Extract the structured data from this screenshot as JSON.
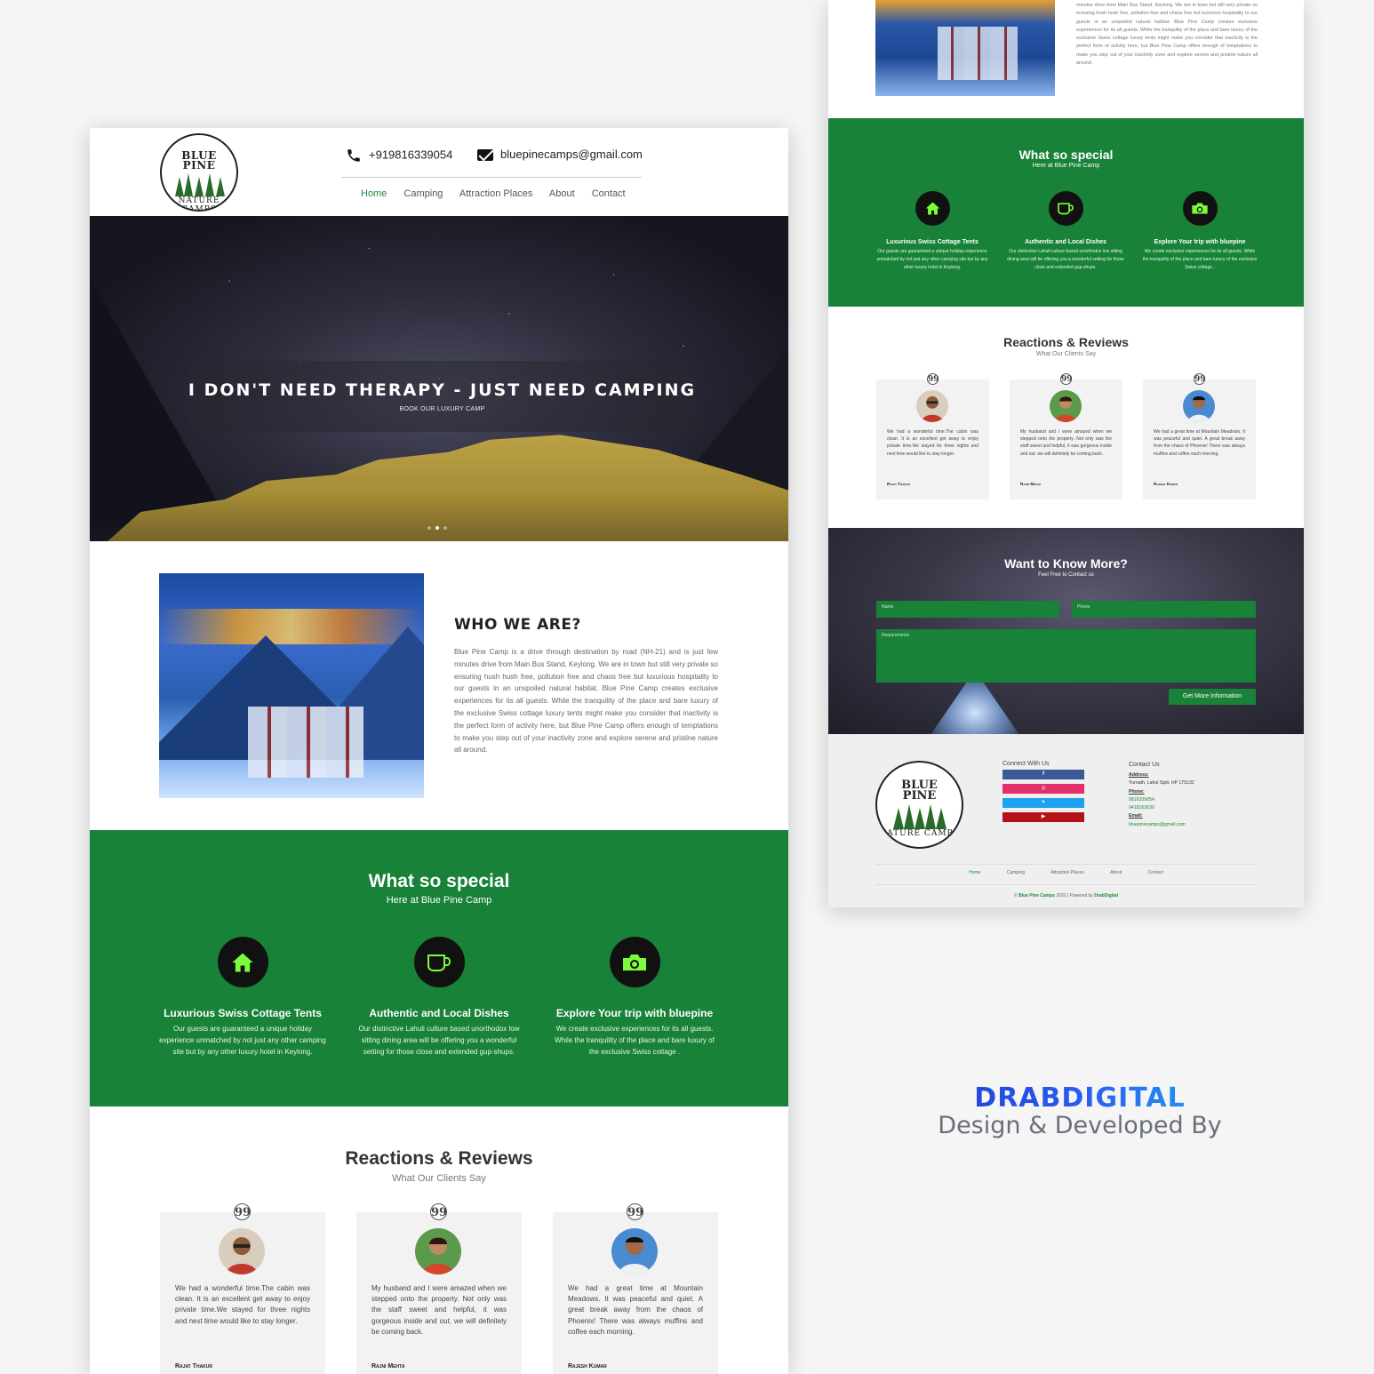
{
  "site": {
    "logo": {
      "line1": "BLUE",
      "line2": "PINE",
      "ring": "NATURE CAMPS"
    },
    "phone": "+919816339054",
    "email": "bluepinecamps@gmail.com",
    "nav": [
      "Home",
      "Camping",
      "Attraction Places",
      "About",
      "Contact"
    ],
    "active_nav": "Home"
  },
  "hero": {
    "title": "I DON'T NEED THERAPY - JUST NEED CAMPING",
    "subtitle": "BOOK OUR LUXURY CAMP"
  },
  "who": {
    "title": "WHO WE ARE?",
    "body": "Blue Pine Camp is a drive through destination by road (NH-21) and is just few minutes drive from Main Bus Stand, Keylong. We are in town but still very private so ensuring hush hush free, pollution free and chaos free but luxurious hospitality to our guests in an unspoiled natural habitat. Blue Pine Camp creates exclusive experiences for its all guests. While the tranquility of the place and bare luxury of the exclusive Swiss cottage luxury tents might make you consider that inactivity is the perfect form of activity here, but Blue Pine Camp offers enough of temptations to make you step out of your inactivity zone and explore serene and pristine nature all around.",
    "body_partial": "minutes drive from Main Bus Stand, Keylong. We are in town but still very private so ensuring hush hush free, pollution free and chaos free but luxurious hospitality to our guests in an unspoiled natural habitat. Blue Pine Camp creates exclusive experiences for its all guests. While the tranquility of the place and bare luxury of the exclusive Swiss cottage luxury tents might make you consider that inactivity is the perfect form of activity here, but Blue Pine Camp offers enough of temptations to make you step out of your inactivity zone and explore serene and pristine nature all around."
  },
  "special": {
    "title": "What so special",
    "subtitle": "Here at Blue Pine Camp",
    "features": [
      {
        "icon": "home-icon",
        "title": "Luxurious Swiss Cottage Tents",
        "text": "Our guests are guaranteed a unique holiday experience unmatched by not just any other camping site but by any other luxury hotel in Keylong."
      },
      {
        "icon": "cup-icon",
        "title": "Authentic and Local Dishes",
        "text": "Our distinctive Lahuli culture based unorthodox low sitting dining area will be offering you a wonderful setting for those close and extended gup-shups."
      },
      {
        "icon": "camera-icon",
        "title": "Explore Your trip with bluepine",
        "text": "We create exclusive experiences for its all guests. While the tranquility of the place and bare luxury of the exclusive Swiss cottage ."
      }
    ]
  },
  "reviews": {
    "title": "Reactions & Reviews",
    "subtitle": "What Our Clients Say",
    "quote_glyph": "99",
    "items": [
      {
        "text": "We had a wonderful time.The cabin was clean. It is an excellent get away to enjoy private time.We stayed for three nights and next time would like to stay longer.",
        "name": "Rajat Thakur"
      },
      {
        "text": "My husband and I were amazed when we stepped onto the property. Not only was the staff sweet and helpful, it was gorgeous inside and out. we will definitely be coming back.",
        "name": "Rajni Mehta"
      },
      {
        "text": "We had a great time at Mountain Meadows. It was peaceful and quiet. A great break away from the chaos of Phoenix! There was always muffins and coffee each morning.",
        "name": "Rajesh Kumar"
      }
    ]
  },
  "contact_form": {
    "title": "Want to Know More?",
    "subtitle": "Feel Free to Contact us",
    "name_placeholder": "Name",
    "phone_placeholder": "Phone",
    "req_placeholder": "Requirements",
    "button": "Get More Information"
  },
  "footer": {
    "connect_title": "Connect With Us",
    "social": [
      {
        "icon": "facebook-icon",
        "glyph": "f",
        "color": "#3b5998"
      },
      {
        "icon": "instagram-icon",
        "glyph": "◎",
        "color": "#e1306c"
      },
      {
        "icon": "twitter-icon",
        "glyph": "✦",
        "color": "#1da1f2"
      },
      {
        "icon": "youtube-icon",
        "glyph": "▶",
        "color": "#b31217"
      }
    ],
    "contact_title": "Contact Us",
    "address_label": "Address:",
    "address": "Yurnath, Lahul Spiti, HP 175132",
    "phone_label": "Phone:",
    "phone1": "9816339054",
    "phone2": "9418163630",
    "email_label": "Email:",
    "email": "bluepinecamps@gmail.com",
    "nav": [
      "Home",
      "Camping",
      "Attraction Places",
      "About",
      "Contact"
    ],
    "copyright_prefix": "© ",
    "copyright_brand": "Blue Pine Camps",
    "copyright_mid": " 2020 | Powered by ",
    "copyright_powered": "DrabDigital"
  },
  "branding": {
    "logo_text": "DRABDIGITAL",
    "tagline": "Design & Developed By"
  },
  "colors": {
    "green": "#188238",
    "accent_green": "#7cfc3a",
    "link_green": "#1e8a3a"
  }
}
